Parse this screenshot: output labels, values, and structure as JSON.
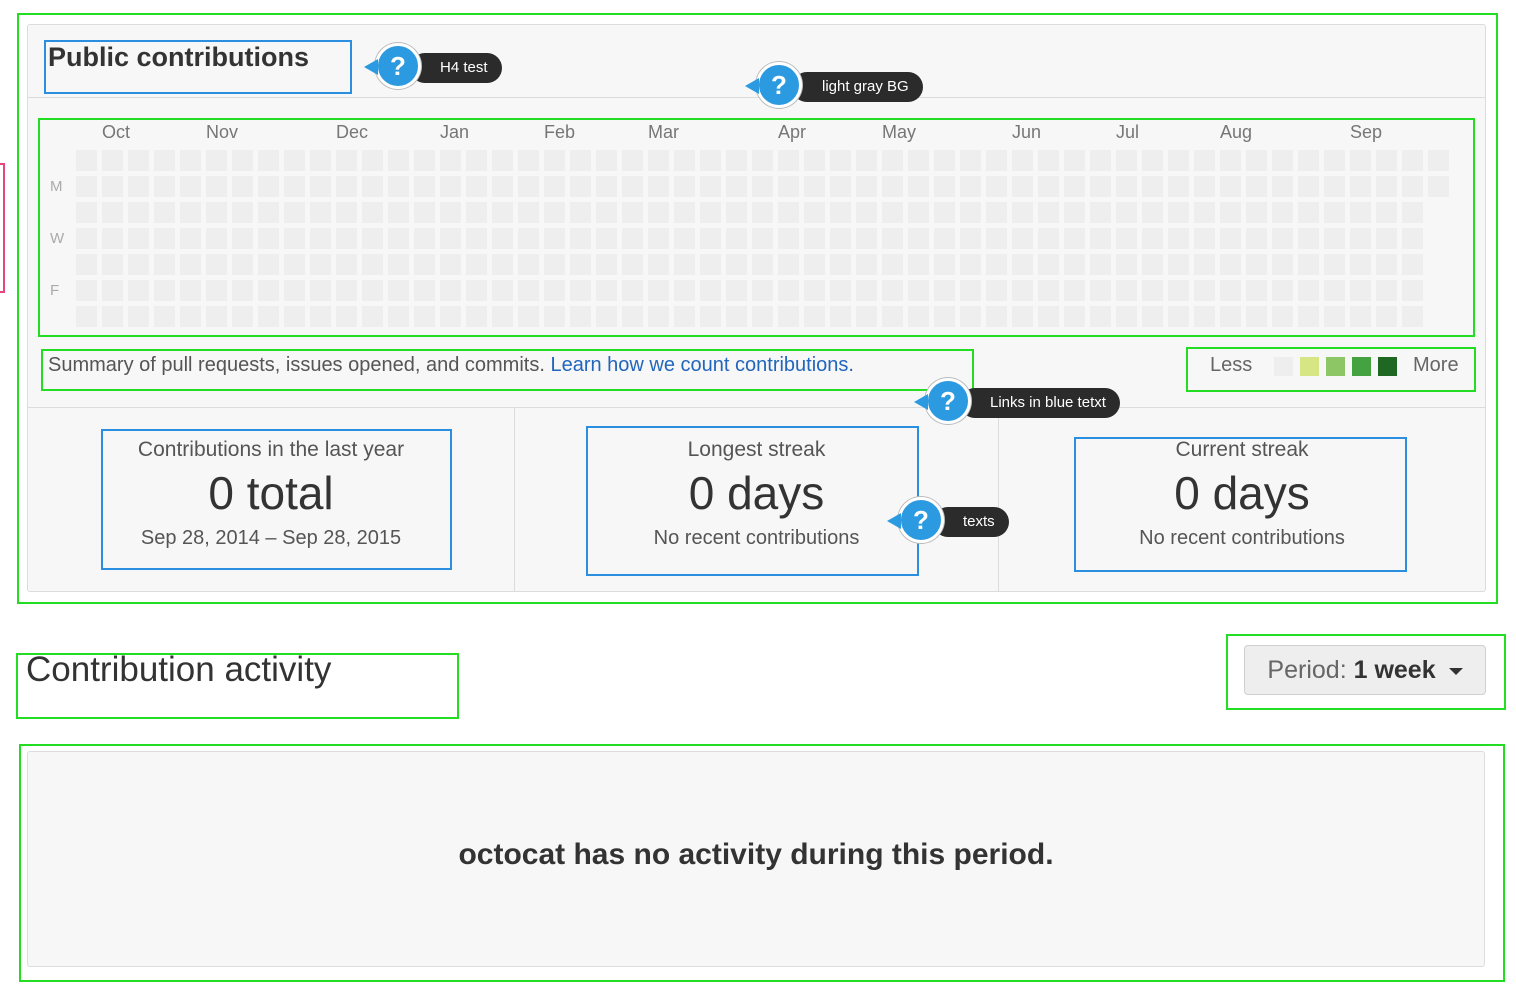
{
  "contributions": {
    "title": "Public contributions",
    "months": [
      "Oct",
      "Nov",
      "Dec",
      "Jan",
      "Feb",
      "Mar",
      "Apr",
      "May",
      "Jun",
      "Jul",
      "Aug",
      "Sep"
    ],
    "day_labels": [
      "M",
      "W",
      "F"
    ],
    "summary_text": "Summary of pull requests, issues opened, and commits.",
    "learn_link": "Learn how we count contributions.",
    "legend_less": "Less",
    "legend_more": "More",
    "legend_colors": [
      "#eeeeee",
      "#d6e685",
      "#8cc665",
      "#44a340",
      "#1e6823"
    ],
    "cell_color": "#eeeeee",
    "stats": [
      {
        "label": "Contributions in the last year",
        "value": "0 total",
        "sub": "Sep 28, 2014 – Sep 28, 2015"
      },
      {
        "label": "Longest streak",
        "value": "0 days",
        "sub": "No recent contributions"
      },
      {
        "label": "Current streak",
        "value": "0 days",
        "sub": "No recent contributions"
      }
    ]
  },
  "annotations": [
    {
      "icon": "?",
      "text": "H4 test"
    },
    {
      "icon": "?",
      "text": "light gray BG"
    },
    {
      "icon": "?",
      "text": "Links in blue tetxt"
    },
    {
      "icon": "?",
      "text": "texts"
    }
  ],
  "activity": {
    "title": "Contribution activity",
    "period_label": "Period:",
    "period_value": "1 week",
    "empty_message": "octocat has no activity during this period."
  }
}
